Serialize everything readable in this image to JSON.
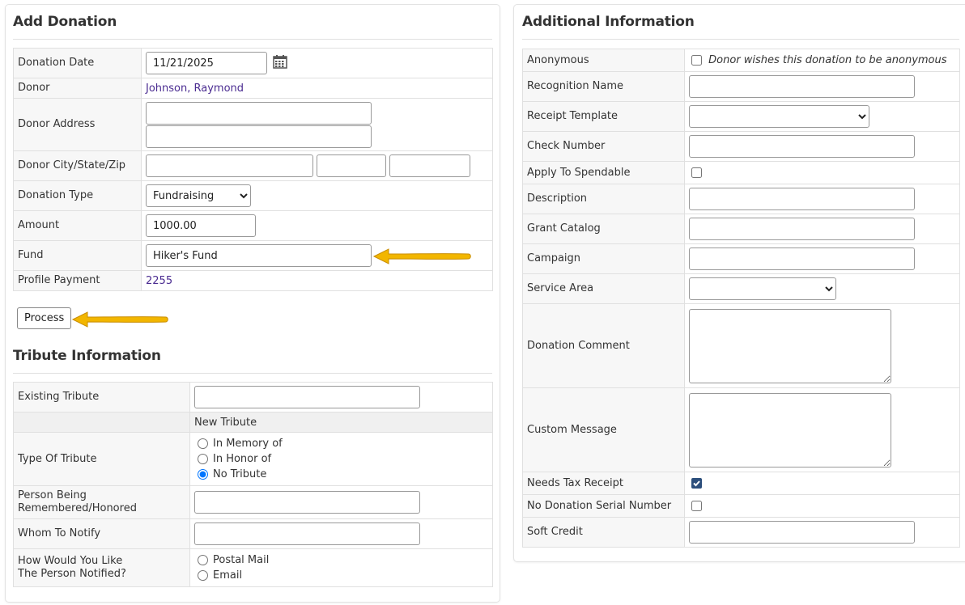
{
  "add_donation": {
    "title": "Add Donation",
    "donation_date_label": "Donation Date",
    "donation_date_value": "11/21/2025",
    "donor_label": "Donor",
    "donor_value": "Johnson, Raymond",
    "donor_address_label": "Donor Address",
    "donor_address_1": "",
    "donor_address_2": "",
    "donor_city_state_zip_label": "Donor City/State/Zip",
    "donor_city": "",
    "donor_state": "",
    "donor_zip": "",
    "donation_type_label": "Donation Type",
    "donation_type_value": "Fundraising",
    "amount_label": "Amount",
    "amount_value": "1000.00",
    "fund_label": "Fund",
    "fund_value": "Hiker's Fund",
    "profile_payment_label": "Profile Payment",
    "profile_payment_value": "2255",
    "process_button": "Process"
  },
  "tribute": {
    "title": "Tribute Information",
    "existing_tribute_label": "Existing Tribute",
    "existing_tribute_value": "",
    "new_tribute_label": "New Tribute",
    "type_label": "Type Of Tribute",
    "type_options": [
      "In Memory of",
      "In Honor of",
      "No Tribute"
    ],
    "type_selected": "No Tribute",
    "person_label_line1": "Person Being",
    "person_label_line2": "Remembered/Honored",
    "person_value": "",
    "whom_label": "Whom To Notify",
    "whom_value": "",
    "how_label_line1": "How Would You Like",
    "how_label_line2": "The Person Notified?",
    "how_options": [
      "Postal Mail",
      "Email"
    ]
  },
  "additional": {
    "title": "Additional Information",
    "anonymous_label": "Anonymous",
    "anonymous_text": "Donor wishes this donation to be anonymous",
    "anonymous_checked": false,
    "recognition_name_label": "Recognition Name",
    "recognition_name_value": "",
    "receipt_template_label": "Receipt Template",
    "receipt_template_value": "",
    "check_number_label": "Check Number",
    "check_number_value": "",
    "apply_spendable_label": "Apply To Spendable",
    "apply_spendable_checked": false,
    "description_label": "Description",
    "description_value": "",
    "grant_catalog_label": "Grant Catalog",
    "grant_catalog_value": "",
    "campaign_label": "Campaign",
    "campaign_value": "",
    "service_area_label": "Service Area",
    "service_area_value": "",
    "donation_comment_label": "Donation Comment",
    "donation_comment_value": "",
    "custom_message_label": "Custom Message",
    "custom_message_value": "",
    "needs_tax_receipt_label": "Needs Tax Receipt",
    "needs_tax_receipt_checked": true,
    "no_serial_label": "No Donation Serial Number",
    "no_serial_checked": false,
    "soft_credit_label": "Soft Credit",
    "soft_credit_value": ""
  },
  "colors": {
    "link": "#4b2c91",
    "label_bg": "#f7f7f7",
    "arrow": "#f2b600",
    "checkbox_checked": "#2c4f7c"
  },
  "icons": {
    "calendar": "calendar-icon",
    "arrow": "annotation-arrow-icon"
  }
}
